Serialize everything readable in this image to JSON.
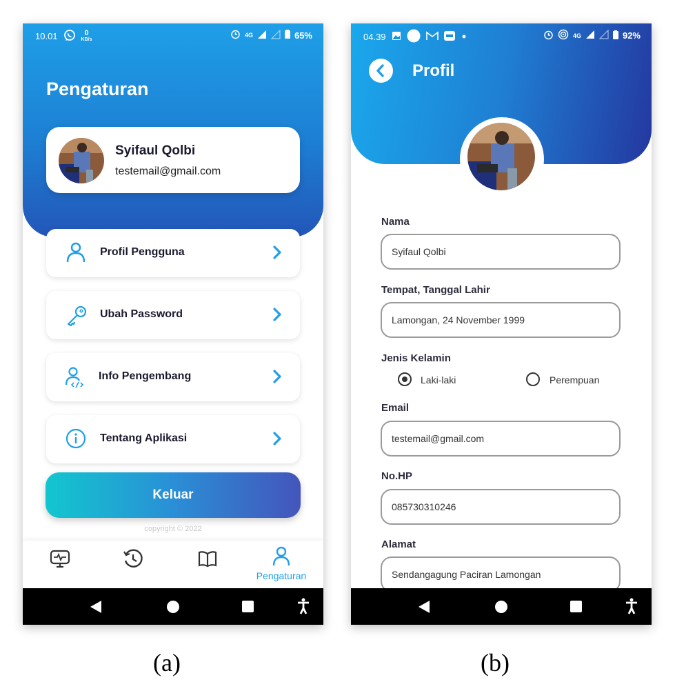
{
  "phone_a": {
    "status": {
      "time": "10.01",
      "net_speed": "0",
      "net_unit": "KB/s",
      "signal": "4G",
      "battery": "65%"
    },
    "title": "Pengaturan",
    "user": {
      "name": "Syifaul Qolbi",
      "email": "testemail@gmail.com"
    },
    "menu": [
      {
        "label": "Profil Pengguna",
        "icon": "user-icon"
      },
      {
        "label": "Ubah Password",
        "icon": "key-icon"
      },
      {
        "label": "Info Pengembang",
        "icon": "developer-icon"
      },
      {
        "label": "Tentang Aplikasi",
        "icon": "info-icon"
      }
    ],
    "logout_label": "Keluar",
    "copyright": "copyright © 2022",
    "bottom_nav": {
      "active_label": "Pengaturan",
      "items": [
        "monitor-icon",
        "history-icon",
        "book-icon",
        "user-icon"
      ]
    }
  },
  "phone_b": {
    "status": {
      "time": "04.39",
      "signal": "4G",
      "battery": "92%"
    },
    "title": "Profil",
    "fields": {
      "name_label": "Nama",
      "name_value": "Syifaul Qolbi",
      "birth_label": "Tempat, Tanggal Lahir",
      "birth_value": "Lamongan, 24 November 1999",
      "gender_label": "Jenis Kelamin",
      "gender_male": "Laki-laki",
      "gender_female": "Perempuan",
      "email_label": "Email",
      "email_value": "testemail@gmail.com",
      "phone_label": "No.HP",
      "phone_value": "085730310246",
      "address_label": "Alamat",
      "address_value": "Sendangagung Paciran Lamongan"
    }
  },
  "captions": {
    "a": "(a)",
    "b": "(b)"
  },
  "colors": {
    "primary": "#1f9fe8",
    "dark_blue": "#2356b8",
    "teal": "#12c6cf",
    "text_dark": "#1a1a2e"
  }
}
